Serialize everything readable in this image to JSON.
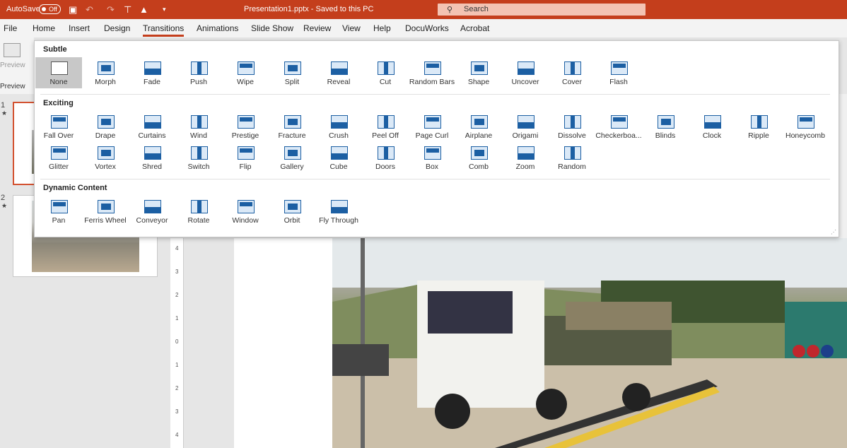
{
  "titlebar": {
    "autosave_label": "AutoSave",
    "autosave_state": "Off",
    "document_title": "Presentation1.pptx  -  Saved to this PC",
    "search_placeholder": "Search",
    "accent": "#c43e1c"
  },
  "menu": {
    "items": [
      "File",
      "Home",
      "Insert",
      "Design",
      "Transitions",
      "Animations",
      "Slide Show",
      "Review",
      "View",
      "Help",
      "DocuWorks",
      "Acrobat"
    ],
    "active": "Transitions"
  },
  "ribbon": {
    "preview_label": "Preview",
    "preview_group": "Preview"
  },
  "thumbnails": {
    "slide1_number": "1",
    "slide2_number": "2"
  },
  "ruler": {
    "marks": [
      "4",
      "3",
      "2",
      "1",
      "0",
      "1",
      "2",
      "3",
      "4"
    ]
  },
  "gallery": {
    "subtle_title": "Subtle",
    "exciting_title": "Exciting",
    "dynamic_title": "Dynamic Content",
    "subtle": [
      "None",
      "Morph",
      "Fade",
      "Push",
      "Wipe",
      "Split",
      "Reveal",
      "Cut",
      "Random Bars",
      "Shape",
      "Uncover",
      "Cover",
      "Flash"
    ],
    "exciting_row1": [
      "Fall Over",
      "Drape",
      "Curtains",
      "Wind",
      "Prestige",
      "Fracture",
      "Crush",
      "Peel Off",
      "Page Curl",
      "Airplane",
      "Origami",
      "Dissolve",
      "Checkerboa...",
      "Blinds",
      "Clock",
      "Ripple",
      "Honeycomb"
    ],
    "exciting_row2": [
      "Glitter",
      "Vortex",
      "Shred",
      "Switch",
      "Flip",
      "Gallery",
      "Cube",
      "Doors",
      "Box",
      "Comb",
      "Zoom",
      "Random"
    ],
    "dynamic": [
      "Pan",
      "Ferris Wheel",
      "Conveyor",
      "Rotate",
      "Window",
      "Orbit",
      "Fly Through"
    ],
    "selected": "None",
    "icon_color": "#1c5fa3"
  }
}
